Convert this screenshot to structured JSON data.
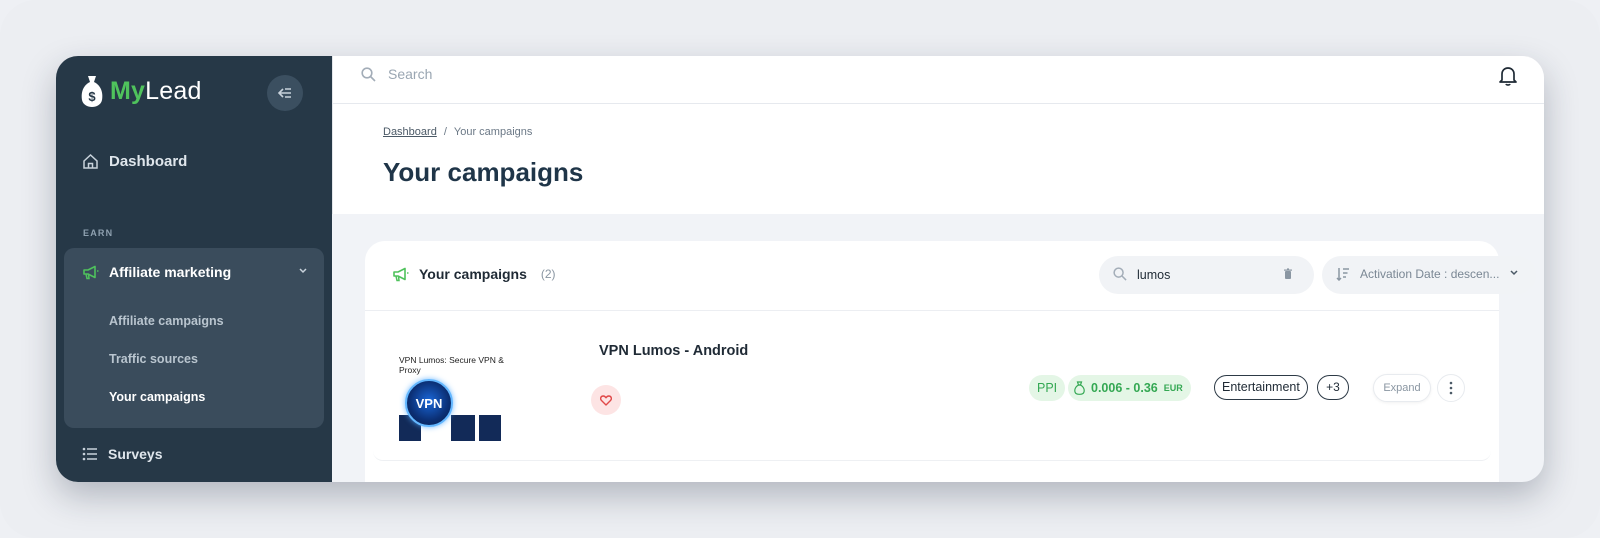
{
  "app": {
    "logo_my": "My",
    "logo_lead": "Lead"
  },
  "sidebar": {
    "dashboard_label": "Dashboard",
    "section_earn": "EARN",
    "affiliate": {
      "label": "Affiliate marketing",
      "items": [
        {
          "label": "Affiliate campaigns",
          "active": false
        },
        {
          "label": "Traffic sources",
          "active": false
        },
        {
          "label": "Your campaigns",
          "active": true
        }
      ]
    },
    "surveys_label": "Surveys"
  },
  "topbar": {
    "search_placeholder": "Search"
  },
  "breadcrumb": {
    "home": "Dashboard",
    "separator": "/",
    "current": "Your campaigns"
  },
  "page": {
    "title": "Your campaigns"
  },
  "card": {
    "title": "Your campaigns",
    "count": "(2)",
    "search_value": "lumos",
    "sort_label": "Activation Date : descen..."
  },
  "campaign": {
    "name": "VPN Lumos - Android",
    "thumb_title": "VPN Lumos: Secure VPN & Proxy",
    "app_logo_text": "VPN",
    "model": "PPI",
    "payout": "0.006 - 0.36",
    "currency": "EUR",
    "category": "Entertainment",
    "more_categories": "+3",
    "expand_label": "Expand"
  },
  "colors": {
    "sidebar_bg": "#263847",
    "brand_green": "#4fc25c",
    "title_navy": "#1f3548"
  }
}
